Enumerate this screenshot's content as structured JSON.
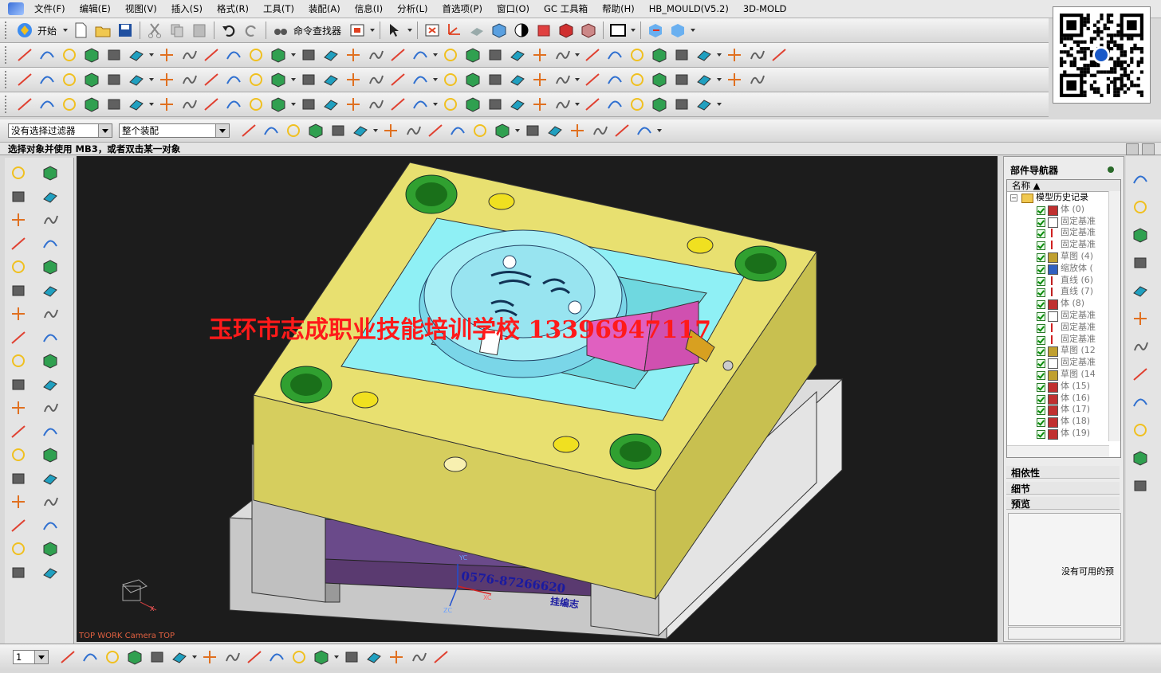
{
  "menubar": {
    "items": [
      "文件(F)",
      "编辑(E)",
      "视图(V)",
      "插入(S)",
      "格式(R)",
      "工具(T)",
      "装配(A)",
      "信息(I)",
      "分析(L)",
      "首选项(P)",
      "窗口(O)",
      "GC 工具箱",
      "帮助(H)",
      "HB_MOULD(V5.2)",
      "3D-MOLD"
    ]
  },
  "standard_toolbar": {
    "start_label": "开始",
    "command_finder_label": "命令查找器"
  },
  "selection_bar": {
    "filter_value": "没有选择过滤器",
    "scope_value": "整个装配"
  },
  "cue_line": "选择对象并使用 MB3，或者双击某一对象",
  "viewport": {
    "watermark": "玉环市志成职业技能培训学校 13396947117",
    "phone_text": "0576-87266620",
    "signature_text": "挂编志",
    "view_caption": "TOP WORK Camera TOP",
    "axis_labels": {
      "yc": "YC",
      "xc": "XC",
      "zc": "ZC",
      "x": "X"
    },
    "colors": {
      "top_plate": "#e8e070",
      "cavity_insert": "#8ff0f5",
      "slider_block": "#e060c0",
      "guide_bushing": "#30c030",
      "support_plate": "#d0d0d0",
      "ejector_plate": "#604080"
    }
  },
  "part_navigator": {
    "title": "部件导航器",
    "column_header": "名称",
    "root_label": "模型历史记录",
    "rows": [
      {
        "icon": "body-icon",
        "label": "体 (0)"
      },
      {
        "icon": "datum-plane-icon",
        "label": "固定基准"
      },
      {
        "icon": "datum-axis-icon",
        "label": "固定基准"
      },
      {
        "icon": "datum-axis-icon",
        "label": "固定基准"
      },
      {
        "icon": "sketch-icon",
        "label": "草图 (4)"
      },
      {
        "icon": "scale-body-icon",
        "label": "缩放体 ("
      },
      {
        "icon": "line-icon",
        "label": "直线 (6)"
      },
      {
        "icon": "line-icon",
        "label": "直线 (7)"
      },
      {
        "icon": "body-icon",
        "label": "体 (8)"
      },
      {
        "icon": "datum-plane-icon",
        "label": "固定基准"
      },
      {
        "icon": "datum-axis-icon",
        "label": "固定基准"
      },
      {
        "icon": "datum-axis-icon",
        "label": "固定基准"
      },
      {
        "icon": "sketch-icon",
        "label": "草图 (12"
      },
      {
        "icon": "datum-plane-icon",
        "label": "固定基准"
      },
      {
        "icon": "sketch-icon",
        "label": "草图 (14"
      },
      {
        "icon": "body-icon",
        "label": "体 (15)"
      },
      {
        "icon": "body-icon",
        "label": "体 (16)"
      },
      {
        "icon": "body-icon",
        "label": "体 (17)"
      },
      {
        "icon": "body-icon",
        "label": "体 (18)"
      },
      {
        "icon": "body-icon",
        "label": "体 (19)"
      }
    ],
    "dependencies_label": "相依性",
    "details_label": "细节",
    "preview_label": "预览",
    "preview_empty_text": "没有可用的预"
  },
  "bottom_toolbar": {
    "layer_value": "1"
  }
}
